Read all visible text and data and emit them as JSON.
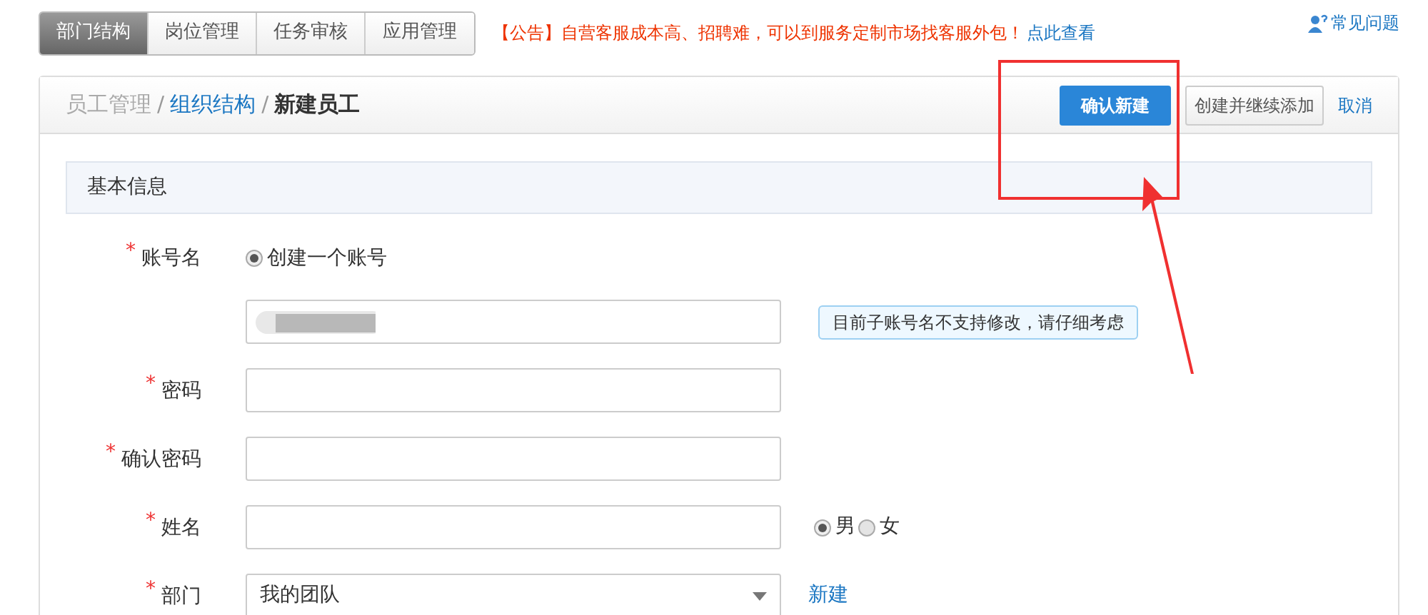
{
  "nav_tabs": [
    {
      "label": "部门结构",
      "selected": true
    },
    {
      "label": "岗位管理",
      "selected": false
    },
    {
      "label": "任务审核",
      "selected": false
    },
    {
      "label": "应用管理",
      "selected": false
    }
  ],
  "notice": {
    "prefix": "【公告】",
    "text": "自营客服成本高、招聘难，可以到服务定制市场找客服外包！",
    "link": "点此查看"
  },
  "help_link": "常见问题",
  "breadcrumb": {
    "separator": "/",
    "items": [
      {
        "label": "员工管理",
        "kind": "muted"
      },
      {
        "label": "组织结构",
        "kind": "link"
      },
      {
        "label": "新建员工",
        "kind": "current"
      }
    ]
  },
  "actions": {
    "primary": "确认新建",
    "secondary": "创建并继续添加",
    "cancel": "取消"
  },
  "section_title": "基本信息",
  "form": [
    {
      "kind": "radio",
      "label": "账号名",
      "required_mark": "*",
      "options": [
        {
          "label": "创建一个账号",
          "selected": true
        }
      ]
    },
    {
      "kind": "input",
      "redacted": true,
      "hint": "目前子账号名不支持修改，请仔细考虑"
    },
    {
      "kind": "input",
      "label": "密码",
      "required_mark": "*"
    },
    {
      "kind": "input",
      "label": "确认密码",
      "required_mark": "*"
    },
    {
      "kind": "input",
      "label": "姓名",
      "required_mark": "*",
      "options": [
        {
          "label": "男",
          "selected": true
        },
        {
          "label": "女",
          "selected": false
        }
      ]
    },
    {
      "kind": "select",
      "label": "部门",
      "required_mark": "*",
      "value": "我的团队",
      "link": "新建"
    }
  ]
}
